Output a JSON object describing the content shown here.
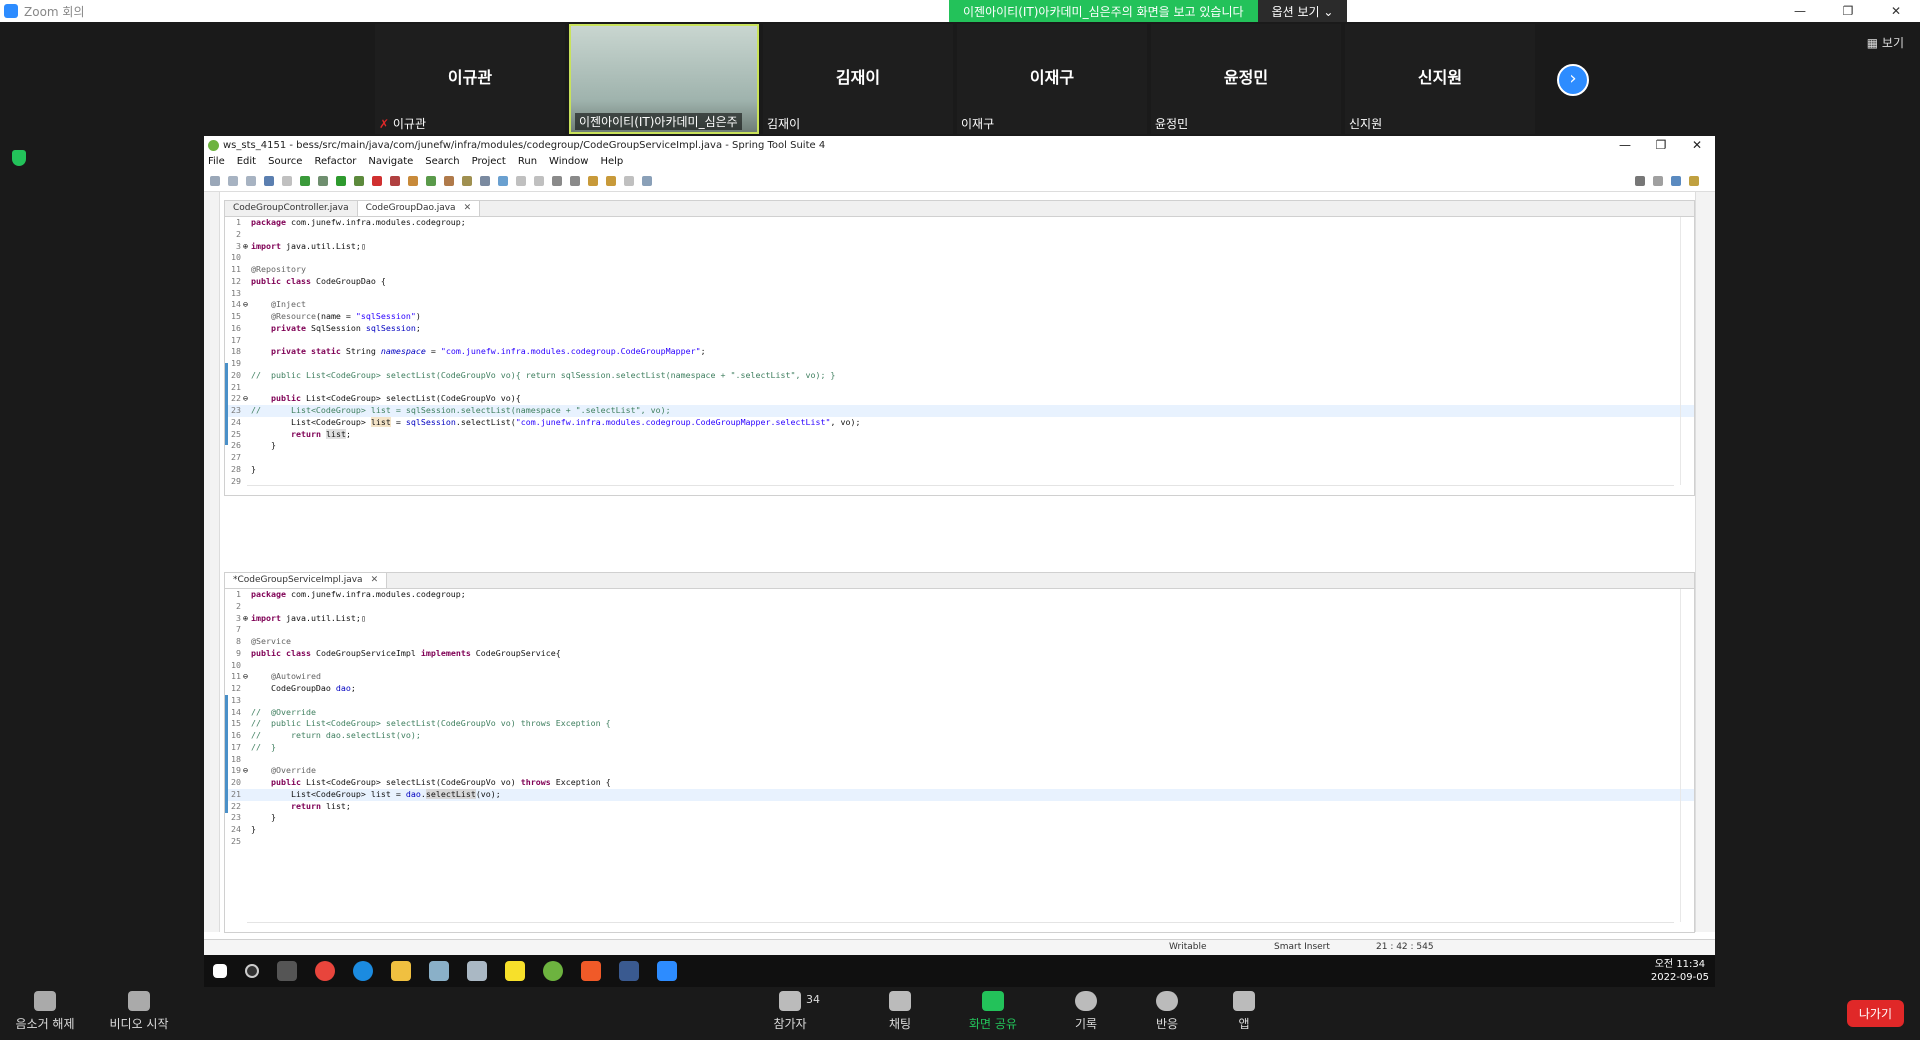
{
  "zoom": {
    "window_title": "Zoom 회의",
    "share_message": "이젠아이티(IT)아카데미_심은주의 화면을 보고 있습니다",
    "options_label": "옵션 보기",
    "view_label": "보기",
    "participants": [
      {
        "big": "이규관",
        "name": "이규관"
      },
      {
        "big": "",
        "name": "이젠아이티(IT)아카데미_심은주"
      },
      {
        "big": "김재이",
        "name": "김재이"
      },
      {
        "big": "이재구",
        "name": "이재구"
      },
      {
        "big": "윤정민",
        "name": "윤정민"
      },
      {
        "big": "신지원",
        "name": "신지원"
      }
    ],
    "controls": {
      "mute": "음소거 해제",
      "video": "비디오 시작",
      "participants": "참가자",
      "participants_count": "34",
      "chat": "채팅",
      "share": "화면 공유",
      "record": "기록",
      "reactions": "반응",
      "apps": "앱",
      "leave": "나가기"
    },
    "colors": {
      "accent": "#2d8cff",
      "share_green": "#23c25a",
      "leave_red": "#e02828"
    }
  },
  "sts": {
    "title": "ws_sts_4151 - bess/src/main/java/com/junefw/infra/modules/codegroup/CodeGroupServiceImpl.java - Spring Tool Suite 4",
    "menu": [
      "File",
      "Edit",
      "Source",
      "Refactor",
      "Navigate",
      "Search",
      "Project",
      "Run",
      "Window",
      "Help"
    ],
    "top_editor": {
      "tabs": [
        {
          "label": "CodeGroupController.java",
          "active": false
        },
        {
          "label": "CodeGroupDao.java",
          "active": true,
          "close": "✕"
        }
      ]
    },
    "bottom_editor": {
      "tabs": [
        {
          "label": "*CodeGroupServiceImpl.java",
          "active": true,
          "close": "✕"
        }
      ]
    },
    "status": {
      "writable": "Writable",
      "insert": "Smart Insert",
      "position": "21 : 42 : 545"
    }
  },
  "taskbar": {
    "time": "오전 11:34",
    "date": "2022-09-05"
  }
}
